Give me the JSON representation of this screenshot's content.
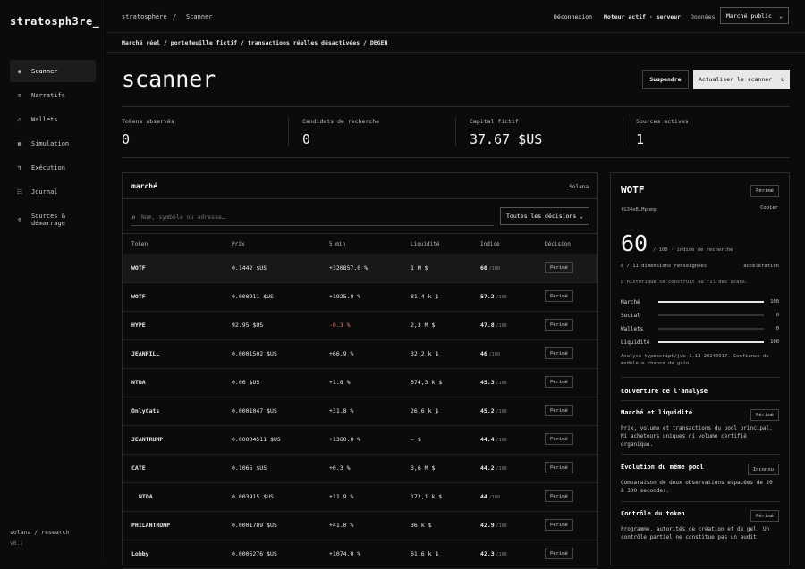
{
  "brand": "stratosph3re_",
  "sidebar": {
    "items": [
      {
        "icon": "●",
        "label": "Scanner"
      },
      {
        "icon": "≡",
        "label": "Narratifs"
      },
      {
        "icon": "◇",
        "label": "Wallets"
      },
      {
        "icon": "▦",
        "label": "Simulation"
      },
      {
        "icon": "↯",
        "label": "Exécution"
      },
      {
        "icon": "☷",
        "label": "Journal"
      },
      {
        "icon": "⊕",
        "label": "Sources & démarrage"
      }
    ],
    "footer": "solana / research",
    "version": "v0.1"
  },
  "topbar": {
    "crumb_root": "stratosphère",
    "crumb_sep": "/",
    "crumb_page": "Scanner",
    "logout": "Déconnexion",
    "engine": "Moteur actif · serveur",
    "data": "Données",
    "market_select": "Marché public"
  },
  "modebar": "Marché réel / portefeuille fictif / transactions réelles désactivées / DEGEN",
  "page": {
    "title": "scanner",
    "suspend": "Suspendre",
    "refresh": "Actualiser le scanner",
    "refresh_icon": "↻"
  },
  "stats": [
    {
      "label": "Tokens observés",
      "value": "0"
    },
    {
      "label": "Candidats de recherche",
      "value": "0"
    },
    {
      "label": "Capital fictif",
      "value": "37.67 $US"
    },
    {
      "label": "Sources actives",
      "value": "1"
    }
  ],
  "market": {
    "title": "marché",
    "chain": "Solana",
    "search_placeholder": "Nom, symbole ou adresse…",
    "filter": "Toutes les décisions",
    "columns": [
      "Token",
      "Prix",
      "5 min",
      "Liquidité",
      "Indice",
      "Décision"
    ],
    "index_suffix": "/100",
    "rows": [
      {
        "token": "WOTF",
        "price": "0.1442 $US",
        "change": "+320857.0 %",
        "liq": "1 M $",
        "index": "60",
        "decision": "Périmé",
        "selected": true
      },
      {
        "token": "WOTF",
        "price": "0.000911 $US",
        "change": "+1925.0 %",
        "liq": "81,4 k $",
        "index": "57.2",
        "decision": "Périmé"
      },
      {
        "token": "HYPE",
        "price": "92.95 $US",
        "change": "-0.3 %",
        "liq": "2,3 M $",
        "index": "47.8",
        "decision": "Périmé",
        "negative": true
      },
      {
        "token": "JEANPILL",
        "price": "0.0001502 $US",
        "change": "+66.9 %",
        "liq": "32,2 k $",
        "index": "46",
        "decision": "Périmé"
      },
      {
        "token": "NTDA",
        "price": "0.06 $US",
        "change": "+1.8 %",
        "liq": "674,3 k $",
        "index": "45.3",
        "decision": "Périmé"
      },
      {
        "token": "OnlyCats",
        "price": "0.0001047 $US",
        "change": "+31.8 %",
        "liq": "26,6 k $",
        "index": "45.2",
        "decision": "Périmé"
      },
      {
        "token": "JEANTRUMP",
        "price": "0.00004511 $US",
        "change": "+1360.0 %",
        "liq": "— $",
        "index": "44.4",
        "decision": "Périmé"
      },
      {
        "token": "CATE",
        "price": "0.1065 $US",
        "change": "+0.3 %",
        "liq": "3,6 M $",
        "index": "44.2",
        "decision": "Périmé"
      },
      {
        "token": "NTDA",
        "price": "0.003915 $US",
        "change": "+11.9 %",
        "liq": "172,1 k $",
        "index": "44",
        "decision": "Périmé",
        "indent": true
      },
      {
        "token": "PHILANTRUMP",
        "price": "0.0001789 $US",
        "change": "+41.0 %",
        "liq": "36 k $",
        "index": "42.9",
        "decision": "Périmé"
      },
      {
        "token": "Lobby",
        "price": "0.0005276 $US",
        "change": "+1074.0 %",
        "liq": "61,6 k $",
        "index": "42.3",
        "decision": "Périmé"
      }
    ]
  },
  "detail": {
    "name": "WOTF",
    "status": "Périmé",
    "address": "fG34eB…Mpump",
    "copy": "Copier",
    "score": "60",
    "score_sub": "/ 100 · indice de recherche",
    "dims": "8 / 11 dimensions renseignées",
    "accel": "accélération",
    "history": "L'historique se construit au fil des scans.",
    "metrics": [
      {
        "label": "Marché",
        "value": "100",
        "fraction": 1.0
      },
      {
        "label": "Social",
        "value": "0",
        "fraction": 0.0
      },
      {
        "label": "Wallets",
        "value": "0",
        "fraction": 0.0
      },
      {
        "label": "Liquidité",
        "value": "100",
        "fraction": 1.0
      }
    ],
    "note": "Analyse typescript/jwe-1.13-20240917. Confiance du modèle = chance de gain.",
    "coverage_title": "Couverture de l'analyse",
    "sections": [
      {
        "title": "Marché et liquidité",
        "status": "Périmé",
        "body": "Prix, volume et transactions du pool principal. Ni acheteurs uniques ni volume certifié organique."
      },
      {
        "title": "Évolution du même pool",
        "status": "Inconnu",
        "body": "Comparaison de deux observations espacées de 20 à 300 secondes."
      },
      {
        "title": "Contrôle du token",
        "status": "Périmé",
        "body": "Programme, autorités de création et de gel. Un contrôle partiel ne constitue pas un audit."
      }
    ]
  }
}
